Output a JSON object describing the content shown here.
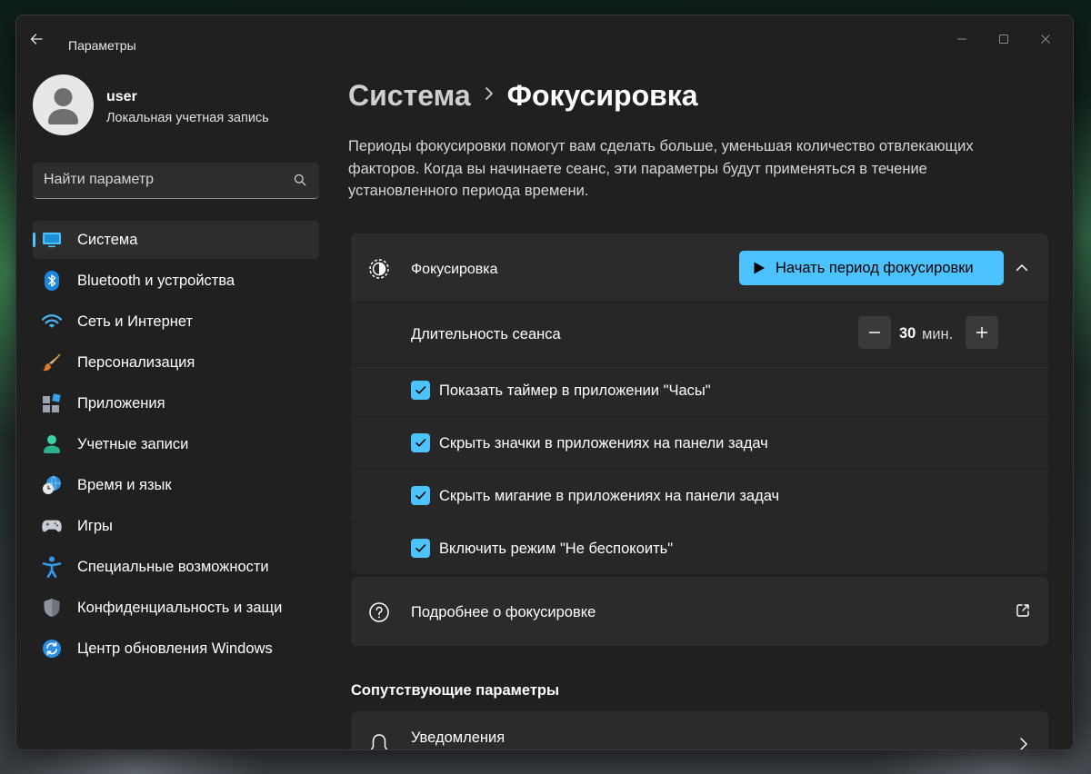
{
  "window": {
    "title": "Параметры"
  },
  "user": {
    "name": "user",
    "account_type": "Локальная учетная запись"
  },
  "search": {
    "placeholder": "Найти параметр"
  },
  "sidebar": {
    "items": [
      {
        "label": "Система",
        "icon": "monitor-icon",
        "active": true
      },
      {
        "label": "Bluetooth и устройства",
        "icon": "bluetooth-icon"
      },
      {
        "label": "Сеть и Интернет",
        "icon": "wifi-icon"
      },
      {
        "label": "Персонализация",
        "icon": "brush-icon"
      },
      {
        "label": "Приложения",
        "icon": "apps-icon"
      },
      {
        "label": "Учетные записи",
        "icon": "person-icon"
      },
      {
        "label": "Время и язык",
        "icon": "globe-clock-icon"
      },
      {
        "label": "Игры",
        "icon": "gamepad-icon"
      },
      {
        "label": "Специальные возможности",
        "icon": "accessibility-icon"
      },
      {
        "label": "Конфиденциальность и защи",
        "icon": "shield-icon"
      },
      {
        "label": "Центр обновления Windows",
        "icon": "update-icon"
      }
    ]
  },
  "breadcrumb": {
    "parent": "Система",
    "current": "Фокусировка"
  },
  "description": "Периоды фокусировки помогут вам сделать больше, уменьшая количество отвлекающих факторов. Когда вы начинаете сеанс, эти параметры будут применяться в течение установленного периода времени.",
  "focus": {
    "title": "Фокусировка",
    "start_button": "Начать период фокусировки",
    "duration_label": "Длительность сеанса",
    "duration_value": "30",
    "duration_unit": "мин.",
    "options": [
      {
        "label": "Показать таймер в приложении \"Часы\"",
        "checked": true
      },
      {
        "label": "Скрыть значки в приложениях на панели задач",
        "checked": true
      },
      {
        "label": "Скрыть мигание в приложениях на панели задач",
        "checked": true
      },
      {
        "label": "Включить режим \"Не беспокоить\"",
        "checked": true
      }
    ]
  },
  "more": {
    "label": "Подробнее о фокусировке"
  },
  "related": {
    "title": "Сопутствующие параметры",
    "notifications_label": "Уведомления"
  },
  "colors": {
    "accent": "#4cc2ff",
    "window_bg": "#202020",
    "card_bg": "#2b2b2b"
  }
}
